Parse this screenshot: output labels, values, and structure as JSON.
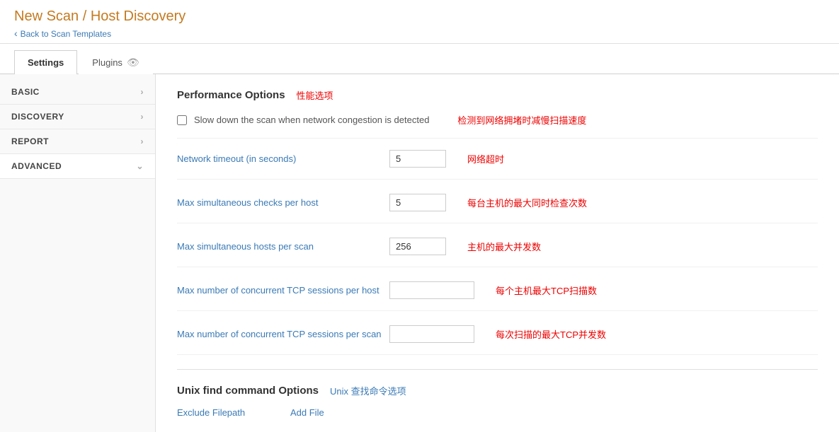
{
  "header": {
    "title": "New Scan / Host Discovery",
    "back_link": "Back to Scan Templates"
  },
  "tabs": [
    {
      "id": "settings",
      "label": "Settings",
      "active": true,
      "icon": null
    },
    {
      "id": "plugins",
      "label": "Plugins",
      "active": false,
      "icon": "eye"
    }
  ],
  "sidebar": {
    "items": [
      {
        "id": "basic",
        "label": "BASIC",
        "chevron": "right"
      },
      {
        "id": "discovery",
        "label": "DISCOVERY",
        "chevron": "right"
      },
      {
        "id": "report",
        "label": "REPORT",
        "chevron": "right"
      },
      {
        "id": "advanced",
        "label": "ADVANCED",
        "chevron": "down",
        "active": true
      }
    ]
  },
  "performance_options": {
    "title": "Performance Options",
    "title_cn": "性能选项",
    "slow_down": {
      "label": "Slow down the scan when network congestion is detected",
      "label_cn": "检测到网络拥堵时减慢扫描速度",
      "checked": false
    },
    "fields": [
      {
        "id": "network_timeout",
        "label": "Network timeout (in seconds)",
        "label_cn": "网络超时",
        "value": "5",
        "wide": false
      },
      {
        "id": "max_checks_per_host",
        "label": "Max simultaneous checks per host",
        "label_cn": "每台主机的最大同时检查次数",
        "value": "5",
        "wide": false
      },
      {
        "id": "max_hosts_per_scan",
        "label": "Max simultaneous hosts per scan",
        "label_cn": "主机的最大并发数",
        "value": "256",
        "wide": false
      },
      {
        "id": "max_tcp_per_host",
        "label": "Max number of concurrent TCP sessions per host",
        "label_cn": "每个主机最大TCP扫描数",
        "value": "",
        "wide": true
      },
      {
        "id": "max_tcp_per_scan",
        "label": "Max number of concurrent TCP sessions per scan",
        "label_cn": "每次扫描的最大TCP并发数",
        "value": "",
        "wide": true
      }
    ]
  },
  "unix_options": {
    "title": "Unix find command Options",
    "title_cn": "Unix 查找命令选项",
    "exclude_filepath": {
      "label": "Exclude Filepath",
      "add_file_label": "Add File"
    }
  }
}
